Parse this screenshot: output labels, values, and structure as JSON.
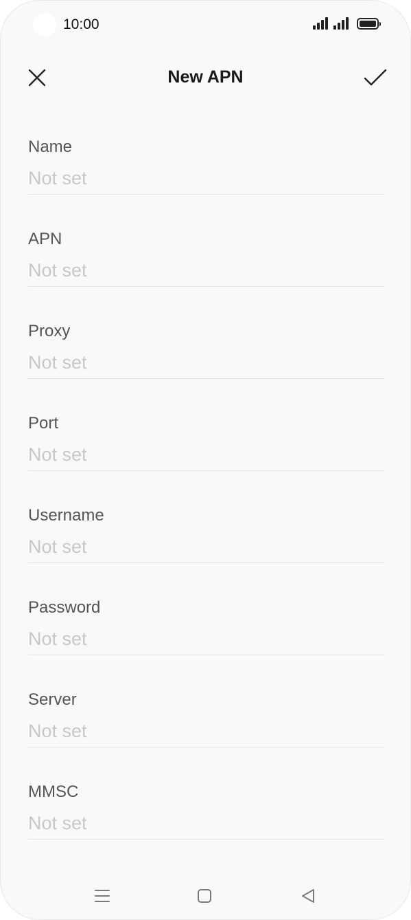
{
  "status_bar": {
    "time": "10:00",
    "icons": [
      "signal-icon",
      "signal-icon",
      "battery-icon"
    ]
  },
  "app_bar": {
    "title": "New APN",
    "close_icon": "close-icon",
    "confirm_icon": "check-icon"
  },
  "fields": [
    {
      "label": "Name",
      "value": "Not set"
    },
    {
      "label": "APN",
      "value": "Not set"
    },
    {
      "label": "Proxy",
      "value": "Not set"
    },
    {
      "label": "Port",
      "value": "Not set"
    },
    {
      "label": "Username",
      "value": "Not set"
    },
    {
      "label": "Password",
      "value": "Not set"
    },
    {
      "label": "Server",
      "value": "Not set"
    },
    {
      "label": "MMSC",
      "value": "Not set"
    }
  ],
  "nav_bar": {
    "icons": [
      "menu-icon",
      "home-icon",
      "back-icon"
    ]
  },
  "colors": {
    "background": "#f9f9f9",
    "label": "#555555",
    "placeholder": "#c8c8c8",
    "divider": "#e2e2e2",
    "title": "#1a1a1a"
  }
}
